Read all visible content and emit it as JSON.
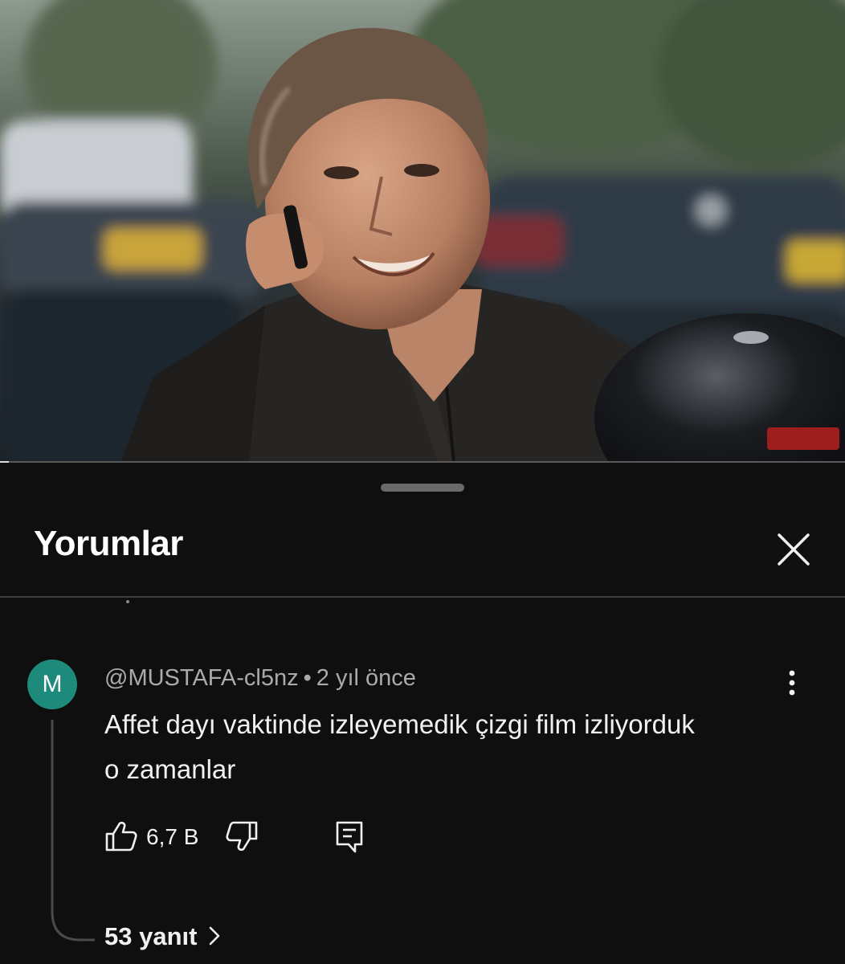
{
  "video": {
    "progress_fraction": 0.01
  },
  "comments_panel": {
    "title": "Yorumlar",
    "close_icon": "close-icon"
  },
  "comment": {
    "avatar_letter": "M",
    "avatar_color": "#1d8a7b",
    "author": "@MUSTAFA-cl5nz",
    "separator": "•",
    "timestamp": "2 yıl önce",
    "text": "Affet dayı vaktinde izleyemedik çizgi film izliyorduk o zamanlar",
    "like_count": "6,7 B",
    "replies_label": "53 yanıt",
    "icons": {
      "like": "thumbs-up-icon",
      "dislike": "thumbs-down-icon",
      "reply": "reply-comment-icon",
      "more": "more-vertical-icon",
      "replies": "chevron-right-icon"
    }
  }
}
